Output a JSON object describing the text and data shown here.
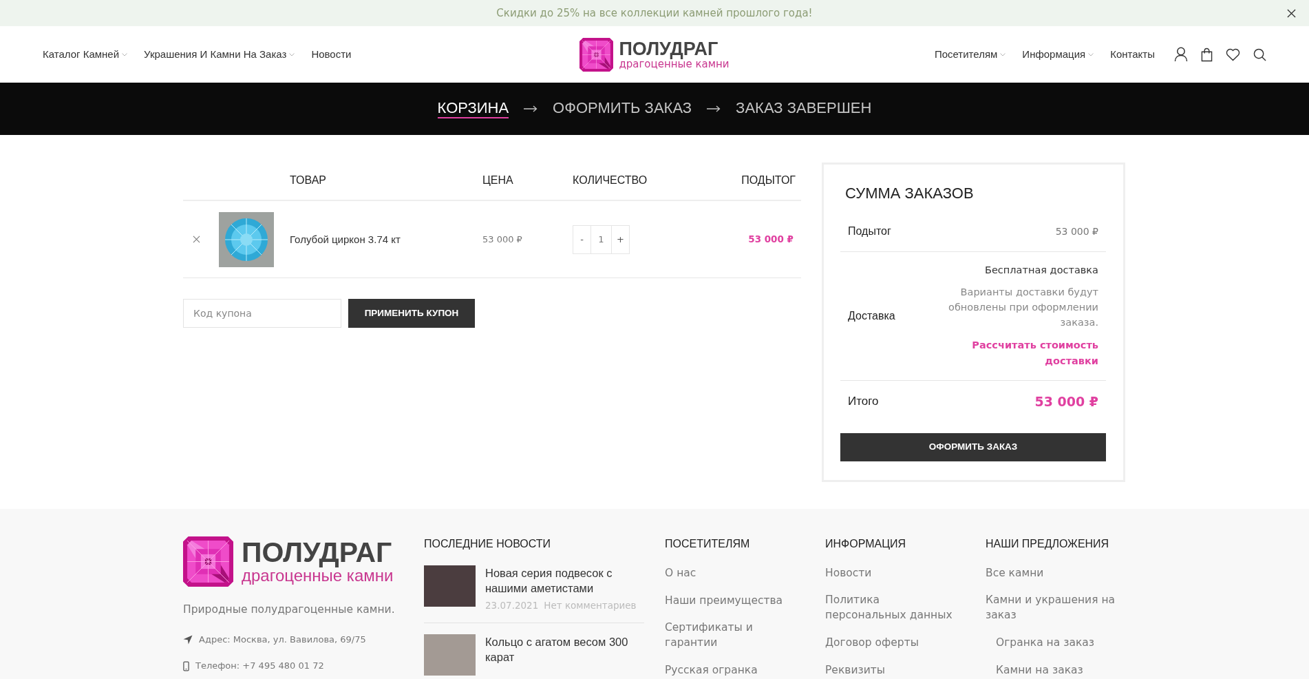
{
  "promo_bar": {
    "text": "Скидки до 25% на все коллекции камней прошлого года!"
  },
  "header": {
    "nav_left": [
      {
        "label": "Каталог Камней",
        "dropdown": true
      },
      {
        "label": "Украшения И Камни На Заказ",
        "dropdown": true
      },
      {
        "label": "Новости",
        "dropdown": false
      }
    ],
    "logo": {
      "title": "ПОЛУДРАГ",
      "subtitle": "драгоценные камни"
    },
    "nav_right": [
      {
        "label": "Посетителям",
        "dropdown": true
      },
      {
        "label": "Информация",
        "dropdown": true
      },
      {
        "label": "Контакты",
        "dropdown": false
      }
    ]
  },
  "checkout_steps": [
    {
      "label": "КОРЗИНА",
      "selected": true
    },
    {
      "label": "ОФОРМИТЬ ЗАКАЗ",
      "selected": false
    },
    {
      "label": "ЗАКАЗ ЗАВЕРШЕН",
      "selected": false
    }
  ],
  "cart": {
    "columns": [
      "ТОВАР",
      "ЦЕНА",
      "КОЛИЧЕСТВО",
      "ПОДЫТОГ"
    ],
    "items": [
      {
        "name": "Голубой циркон 3.74 кт",
        "price": "53 000 ₽",
        "quantity": {
          "decrement": "-",
          "value": "1",
          "increment": "+"
        },
        "subtotal": "53 000 ₽"
      }
    ],
    "coupon": {
      "placeholder": "Код купона",
      "button": "ПРИМЕНИТЬ КУПОН"
    }
  },
  "cart_totals": {
    "title": "СУММА ЗАКАЗОВ",
    "subtotal": {
      "label": "Подытог",
      "value": "53 000 ₽"
    },
    "shipping": {
      "label": "Доставка",
      "method": "Бесплатная доставка",
      "note": "Варианты доставки будут обновлены при оформлении заказа.",
      "calculate_link": "Рассчитать стоимость доставки"
    },
    "total": {
      "label": "Итого",
      "value": "53 000 ₽"
    },
    "checkout_button": "ОФОРМИТЬ ЗАКАЗ"
  },
  "footer": {
    "logo": {
      "title": "ПОЛУДРАГ",
      "subtitle": "драгоценные камни"
    },
    "tagline": "Природные полудрагоценные камни.",
    "contacts": [
      {
        "kind": "address",
        "text": "Адрес: Москва, ул. Вавилова, 69/75"
      },
      {
        "kind": "phone",
        "text": "Телефон: +7 495 480 01 72"
      }
    ],
    "news": {
      "title": "ПОСЛЕДНИЕ НОВОСТИ",
      "items": [
        {
          "title": "Новая серия подвесок с нашими аметистами",
          "date": "23.07.2021",
          "comments": "Нет комментариев"
        },
        {
          "title": "Кольцо с агатом весом 300 карат"
        }
      ]
    },
    "link_columns": [
      {
        "title": "ПОСЕТИТЕЛЯМ",
        "links": [
          {
            "label": "О нас"
          },
          {
            "label": "Наши преимущества"
          },
          {
            "label": "Сертификаты и гарантии"
          },
          {
            "label": "Русская огранка"
          }
        ]
      },
      {
        "title": "ИНФОРМАЦИЯ",
        "links": [
          {
            "label": "Новости"
          },
          {
            "label": "Политика персональных данных"
          },
          {
            "label": "Договор оферты"
          },
          {
            "label": "Реквизиты"
          }
        ]
      },
      {
        "title": "НАШИ ПРЕДЛОЖЕНИЯ",
        "links": [
          {
            "label": "Все камни"
          },
          {
            "label": "Камни и украшения на заказ",
            "children": [
              {
                "label": "Огранка на заказ"
              },
              {
                "label": "Камни на заказ"
              }
            ]
          }
        ]
      }
    ]
  }
}
